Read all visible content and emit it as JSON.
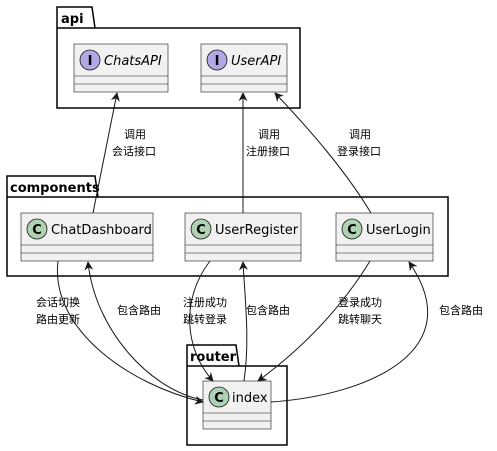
{
  "packages": {
    "api": "api",
    "components": "components",
    "router": "router"
  },
  "classes": {
    "chats_api": {
      "name": "ChatsAPI",
      "badge": "I"
    },
    "user_api": {
      "name": "UserAPI",
      "badge": "I"
    },
    "chat_dashboard": {
      "name": "ChatDashboard",
      "badge": "C"
    },
    "user_register": {
      "name": "UserRegister",
      "badge": "C"
    },
    "user_login": {
      "name": "UserLogin",
      "badge": "C"
    },
    "index": {
      "name": "index",
      "badge": "C"
    }
  },
  "edges": {
    "dashboard_to_chats": [
      "调用",
      "会话接口"
    ],
    "register_to_userapi": [
      "调用",
      "注册接口"
    ],
    "login_to_userapi": [
      "调用",
      "登录接口"
    ],
    "dashboard_to_index": [
      "会话切换",
      "路由更新"
    ],
    "index_to_dashboard": [
      "包含路由"
    ],
    "register_to_index": [
      "注册成功",
      "跳转登录"
    ],
    "index_to_register": [
      "包含路由"
    ],
    "login_to_index": [
      "登录成功",
      "跳转聊天"
    ],
    "index_to_login": [
      "包含路由"
    ]
  },
  "colors": {
    "interface_badge": "#b4a7e5",
    "class_badge": "#add1b2",
    "class_fill": "#f1f1f1"
  }
}
